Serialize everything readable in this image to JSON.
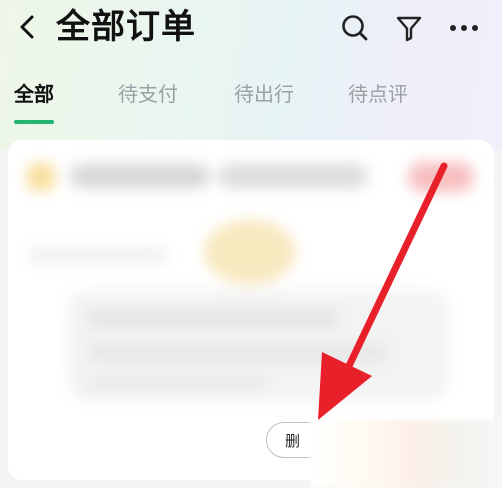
{
  "header": {
    "title": "全部订单",
    "back_icon": "chevron-left-icon",
    "actions": [
      {
        "name": "search-icon"
      },
      {
        "name": "filter-icon"
      },
      {
        "name": "more-icon"
      }
    ]
  },
  "tabs": [
    {
      "label": "全部",
      "active": true
    },
    {
      "label": "待支付",
      "active": false
    },
    {
      "label": "待出行",
      "active": false
    },
    {
      "label": "待点评",
      "active": false
    }
  ],
  "order_card": {
    "delete_label": "删"
  },
  "colors": {
    "accent": "#22b573",
    "annotation_arrow": "#e8202a"
  }
}
